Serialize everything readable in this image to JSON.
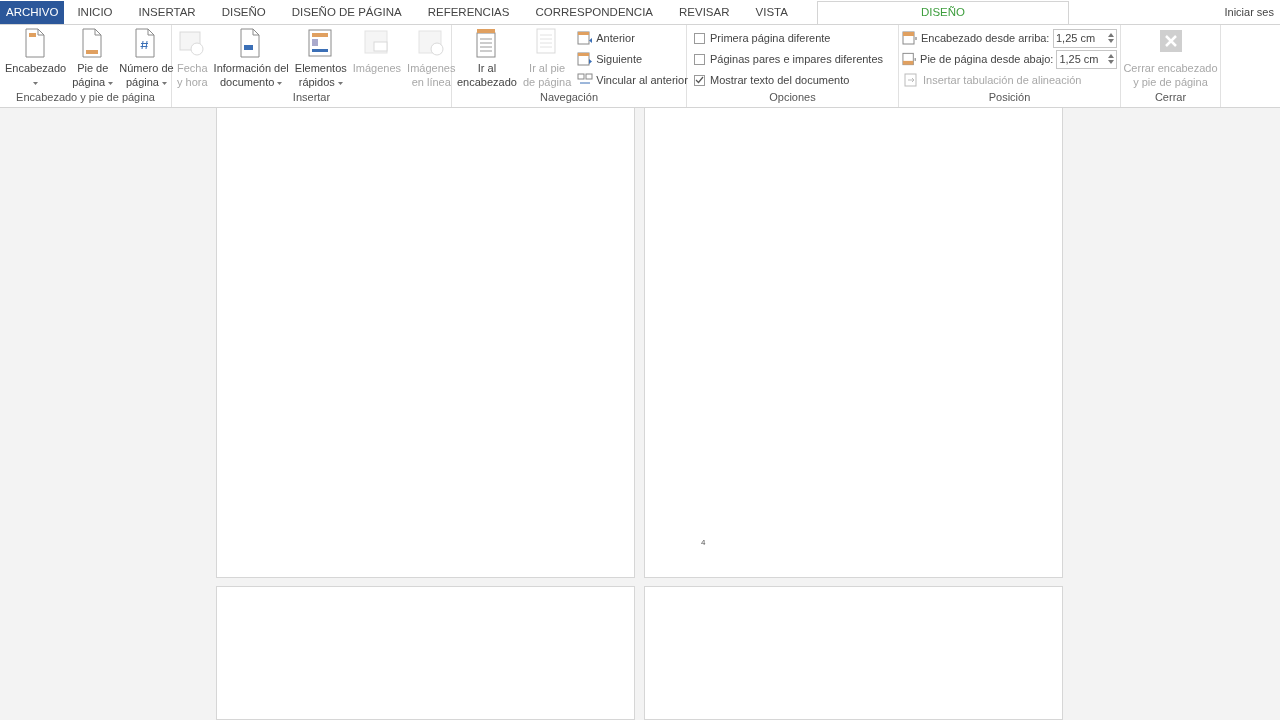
{
  "tabs": [
    {
      "label": "ARCHIVO",
      "kind": "file",
      "selected": false
    },
    {
      "label": "INICIO",
      "kind": "normal",
      "selected": false
    },
    {
      "label": "INSERTAR",
      "kind": "normal",
      "selected": false
    },
    {
      "label": "DISEÑO",
      "kind": "normal",
      "selected": false
    },
    {
      "label": "DISEÑO DE PÁGINA",
      "kind": "normal",
      "selected": false
    },
    {
      "label": "REFERENCIAS",
      "kind": "normal",
      "selected": false
    },
    {
      "label": "CORRESPONDENCIA",
      "kind": "normal",
      "selected": false
    },
    {
      "label": "REVISAR",
      "kind": "normal",
      "selected": false
    },
    {
      "label": "VISTA",
      "kind": "normal",
      "selected": false
    },
    {
      "label": "DISEÑO",
      "kind": "contextual",
      "selected": true
    }
  ],
  "account": "Iniciar ses",
  "groups": [
    {
      "label": "Encabezado y pie de página",
      "columns": [
        [
          {
            "kind": "large",
            "lines": [
              "Encabezado"
            ],
            "dropdown": true,
            "disabled": false
          }
        ],
        [
          {
            "kind": "large",
            "lines": [
              "Pie de",
              "página"
            ],
            "dropdown": true,
            "disabled": false
          }
        ],
        [
          {
            "kind": "large",
            "lines": [
              "Número de",
              "página"
            ],
            "dropdown": true,
            "disabled": false
          }
        ]
      ]
    },
    {
      "label": "Insertar",
      "columns": [
        [
          {
            "kind": "large",
            "lines": [
              "Fecha",
              "y hora"
            ],
            "dropdown": false,
            "disabled": true
          }
        ],
        [
          {
            "kind": "large",
            "lines": [
              "Información del",
              "documento"
            ],
            "dropdown": true,
            "disabled": false
          }
        ],
        [
          {
            "kind": "large",
            "lines": [
              "Elementos",
              "rápidos"
            ],
            "dropdown": true,
            "disabled": false
          }
        ],
        [
          {
            "kind": "large",
            "lines": [
              "Imágenes"
            ],
            "dropdown": false,
            "disabled": true
          }
        ],
        [
          {
            "kind": "large",
            "lines": [
              "Imágenes",
              "en línea"
            ],
            "dropdown": false,
            "disabled": true
          }
        ]
      ]
    },
    {
      "label": "Navegación",
      "columns": [
        [
          {
            "kind": "large",
            "lines": [
              "Ir al",
              "encabezado"
            ],
            "dropdown": false,
            "disabled": false
          }
        ],
        [
          {
            "kind": "large",
            "lines": [
              "Ir al pie",
              "de página"
            ],
            "dropdown": false,
            "disabled": true
          }
        ],
        [
          {
            "kind": "small",
            "label": "Anterior",
            "disabled": false
          },
          {
            "kind": "small",
            "label": "Siguiente",
            "disabled": false
          },
          {
            "kind": "small",
            "label": "Vincular al anterior",
            "disabled": false
          }
        ]
      ]
    },
    {
      "label": "Opciones",
      "columns": [
        [
          {
            "kind": "checkbox",
            "label": "Primera página diferente",
            "checked": false
          },
          {
            "kind": "checkbox",
            "label": "Páginas pares e impares diferentes",
            "checked": false
          },
          {
            "kind": "checkbox",
            "label": "Mostrar texto del documento",
            "checked": true
          }
        ]
      ]
    },
    {
      "label": "Posición",
      "columns": [
        [
          {
            "kind": "spin",
            "label": "Encabezado desde arriba:",
            "value": "1,25 cm"
          },
          {
            "kind": "spin",
            "label": "Pie de página desde abajo:",
            "value": "1,25 cm"
          },
          {
            "kind": "small",
            "label": "Insertar tabulación de alineación",
            "disabled": true
          }
        ]
      ]
    },
    {
      "label": "Cerrar",
      "columns": [
        [
          {
            "kind": "large",
            "lines": [
              "Cerrar encabezado",
              "y pie de página"
            ],
            "dropdown": false,
            "disabled": true
          }
        ]
      ]
    }
  ],
  "page_number": "4"
}
